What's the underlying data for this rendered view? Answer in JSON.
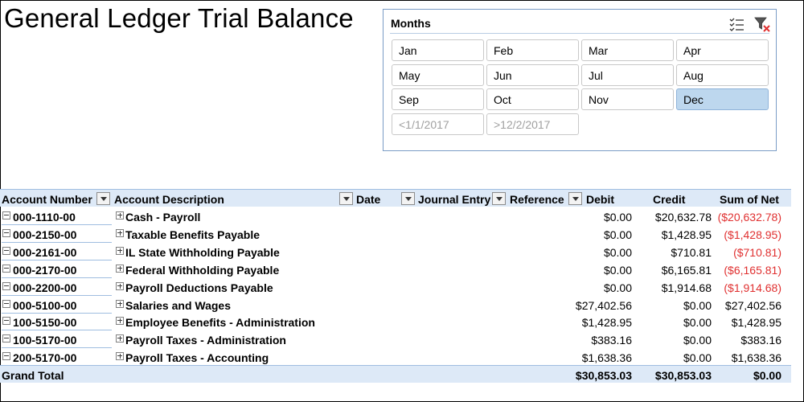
{
  "title": "General Ledger Trial Balance",
  "slicer": {
    "title": "Months",
    "multi_select_label": "Multi-Select",
    "clear_filter_label": "Clear Filter",
    "items": [
      {
        "label": "Jan",
        "selected": false
      },
      {
        "label": "Feb",
        "selected": false
      },
      {
        "label": "Mar",
        "selected": false
      },
      {
        "label": "Apr",
        "selected": false
      },
      {
        "label": "May",
        "selected": false
      },
      {
        "label": "Jun",
        "selected": false
      },
      {
        "label": "Jul",
        "selected": false
      },
      {
        "label": "Aug",
        "selected": false
      },
      {
        "label": "Sep",
        "selected": false
      },
      {
        "label": "Oct",
        "selected": false
      },
      {
        "label": "Nov",
        "selected": false
      },
      {
        "label": "Dec",
        "selected": true
      },
      {
        "label": "<1/1/2017",
        "selected": false,
        "no_data": true
      },
      {
        "label": ">12/2/2017",
        "selected": false,
        "no_data": true
      }
    ]
  },
  "pivot": {
    "headers": {
      "account_number": "Account Number",
      "account_description": "Account Description",
      "date": "Date",
      "journal_entry": "Journal Entry",
      "reference": "Reference",
      "debit": "Debit",
      "credit": "Credit",
      "sum_of_net": "Sum of Net"
    },
    "rows": [
      {
        "account": "000-1110-00",
        "description": "Cash - Payroll",
        "debit": "$0.00",
        "credit": "$20,632.78",
        "net": "($20,632.78)",
        "negative": true
      },
      {
        "account": "000-2150-00",
        "description": "Taxable Benefits Payable",
        "debit": "$0.00",
        "credit": "$1,428.95",
        "net": "($1,428.95)",
        "negative": true
      },
      {
        "account": "000-2161-00",
        "description": "IL State Withholding Payable",
        "debit": "$0.00",
        "credit": "$710.81",
        "net": "($710.81)",
        "negative": true
      },
      {
        "account": "000-2170-00",
        "description": "Federal Withholding Payable",
        "debit": "$0.00",
        "credit": "$6,165.81",
        "net": "($6,165.81)",
        "negative": true
      },
      {
        "account": "000-2200-00",
        "description": "Payroll Deductions Payable",
        "debit": "$0.00",
        "credit": "$1,914.68",
        "net": "($1,914.68)",
        "negative": true
      },
      {
        "account": "000-5100-00",
        "description": "Salaries and Wages",
        "debit": "$27,402.56",
        "credit": "$0.00",
        "net": "$27,402.56",
        "negative": false
      },
      {
        "account": "100-5150-00",
        "description": "Employee Benefits - Administration",
        "debit": "$1,428.95",
        "credit": "$0.00",
        "net": "$1,428.95",
        "negative": false
      },
      {
        "account": "100-5170-00",
        "description": "Payroll Taxes - Administration",
        "debit": "$383.16",
        "credit": "$0.00",
        "net": "$383.16",
        "negative": false
      },
      {
        "account": "200-5170-00",
        "description": "Payroll Taxes - Accounting",
        "debit": "$1,638.36",
        "credit": "$0.00",
        "net": "$1,638.36",
        "negative": false
      }
    ],
    "grand_total": {
      "label": "Grand Total",
      "debit": "$30,853.03",
      "credit": "$30,853.03",
      "net": "$0.00"
    }
  },
  "colors": {
    "negative": "#e03030",
    "header_band": "#dde9f7",
    "selected_slicer": "#bdd7ee"
  }
}
